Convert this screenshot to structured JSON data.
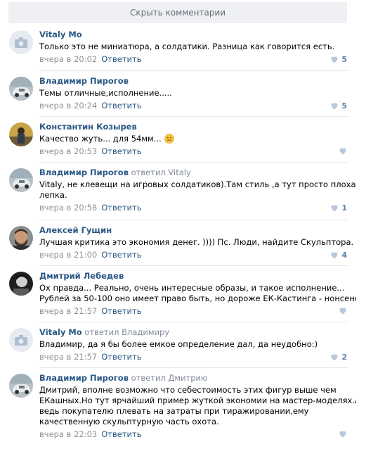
{
  "hide_comments": "Скрыть комментарии",
  "reply_label": "Ответить",
  "comments": [
    {
      "author": "Vitaly Mo",
      "reply_to": "",
      "text": [
        "Только это не миниатюра, а солдатики. Разница как говорится есть."
      ],
      "time": "вчера в 20:02",
      "likes": "5",
      "avatar": "placeholder"
    },
    {
      "author": "Владимир Пирогов",
      "reply_to": "",
      "text": [
        "Темы отличные,исполнение....."
      ],
      "time": "вчера в 20:24",
      "likes": "5",
      "avatar": "car"
    },
    {
      "author": "Константин Козырев",
      "reply_to": "",
      "text": [
        "Качество жуть... для 54мм..."
      ],
      "time": "вчера в 20:53",
      "likes": "",
      "avatar": "person-yellow",
      "emoji": "confused-face-emoji"
    },
    {
      "author": "Владимир Пирогов",
      "reply_to": "ответил Vitaly",
      "text": [
        "Vitaly, не клевещи на игровых солдатиков).Там стиль ,а тут просто плохая",
        "лепка."
      ],
      "time": "вчера в 20:58",
      "likes": "1",
      "avatar": "car"
    },
    {
      "author": "Алексей Гущин",
      "reply_to": "",
      "text": [
        "Лучшая критика это экономия денег. )))) Пс. Люди, найдите Скульптора."
      ],
      "time": "вчера в 21:00",
      "likes": "4",
      "avatar": "bearded"
    },
    {
      "author": "Дмитрий Лебедев",
      "reply_to": "",
      "text": [
        "Ох правда... Реально, очень интересные образы, и такое исполнение...",
        "Рублей за 50-100 оно имеет право быть, но дороже ЕК-Кастинга - нонсенс..."
      ],
      "time": "вчера в 21:57",
      "likes": "",
      "avatar": "bw"
    },
    {
      "author": "Vitaly Mo",
      "reply_to": "ответил Владимиру",
      "text": [
        "Владимир, да я бы более емкое определение дал, да неудобно:)"
      ],
      "time": "вчера в 21:57",
      "likes": "2",
      "avatar": "placeholder"
    },
    {
      "author": "Владимир Пирогов",
      "reply_to": "ответил Дмитрию",
      "text": [
        "Дмитрий, вполне возможно что себестоимость этих фигур выше чем",
        "ЕКашных.Но тут ярчайший пример жуткой экономии на мастер-моделях.А",
        "ведь покупателю плевать на затраты при тиражировании,ему",
        "качественную скульптурную часть охота."
      ],
      "time": "вчера в 22:03",
      "likes": "",
      "avatar": "car"
    }
  ],
  "colors": {
    "link": "#2a5885",
    "muted": "#939393",
    "separator": "#e7e8ec",
    "hide_bar_bg": "#eef0f3"
  }
}
